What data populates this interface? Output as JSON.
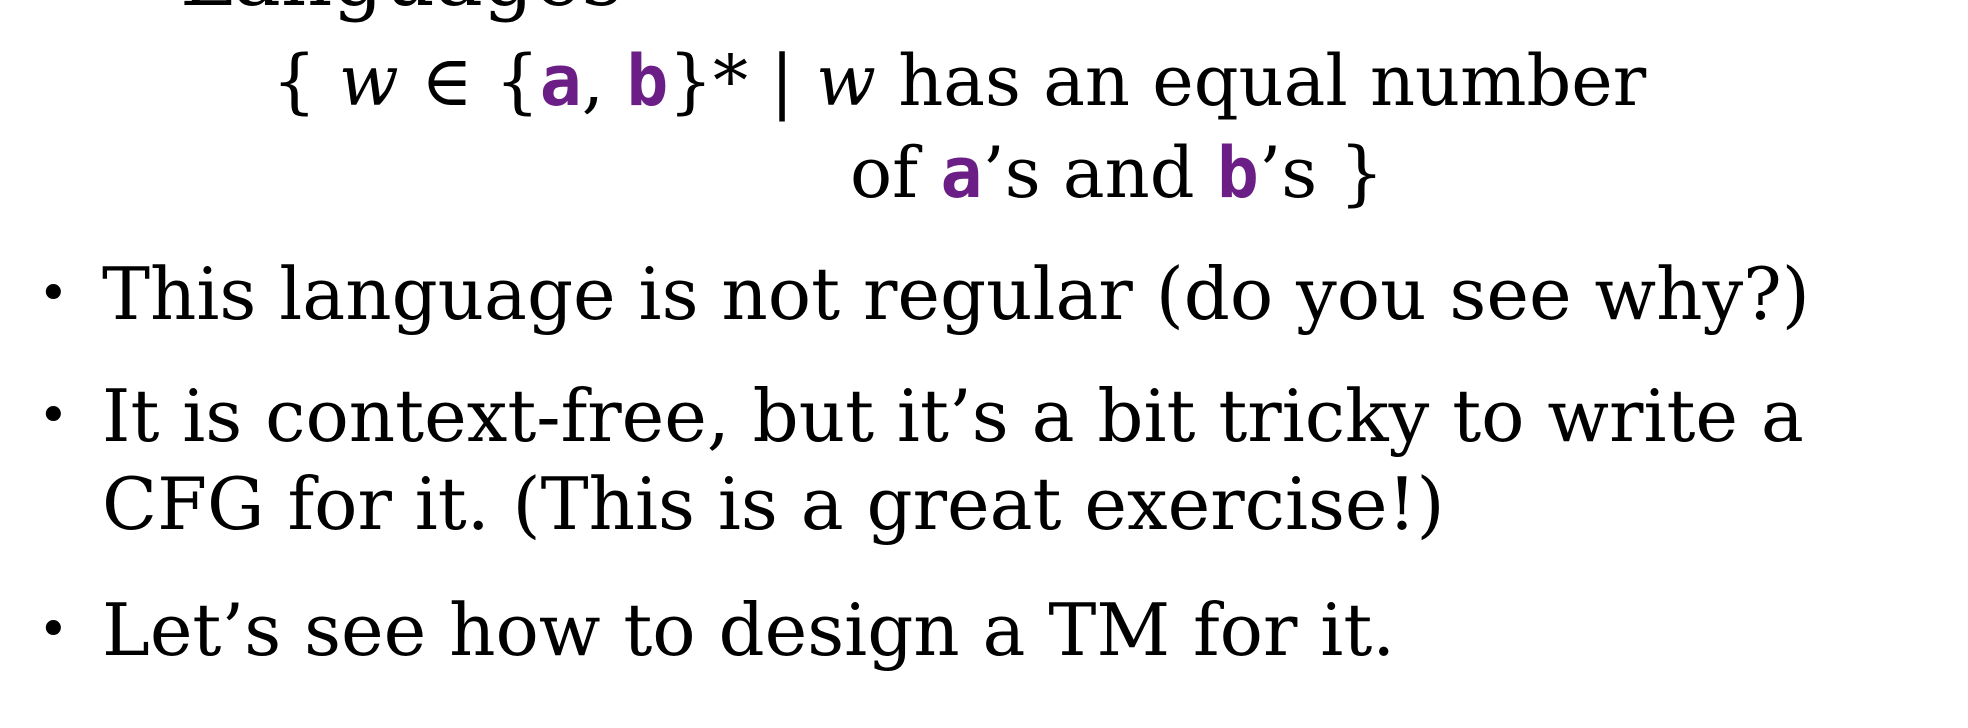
{
  "cut_line_text": "Languages",
  "set_definition": {
    "open_brace": "{ ",
    "var1": "w",
    "member_of": " ∈ {",
    "sym_a": "a",
    "comma": ", ",
    "sym_b": "b",
    "close_alphabet": "}* | ",
    "var2": "w",
    "condition1": " has an equal number",
    "condition2_start": "of ",
    "sym_a2": "a",
    "condition2_mid": "’s and ",
    "sym_b2": "b",
    "condition2_end": "’s }"
  },
  "bullets": [
    {
      "marker": "•",
      "lines": [
        "This language is not regular (do you see why?)"
      ]
    },
    {
      "marker": "•",
      "lines": [
        "It is context-free, but it’s a bit tricky to write a",
        "CFG for it. (This is a great exercise!)"
      ]
    },
    {
      "marker": "•",
      "lines": [
        "Let’s see how to design a TM for it."
      ]
    }
  ],
  "colors": {
    "symbol_accent": "#6b1e86",
    "text": "#000000",
    "background": "#ffffff"
  }
}
